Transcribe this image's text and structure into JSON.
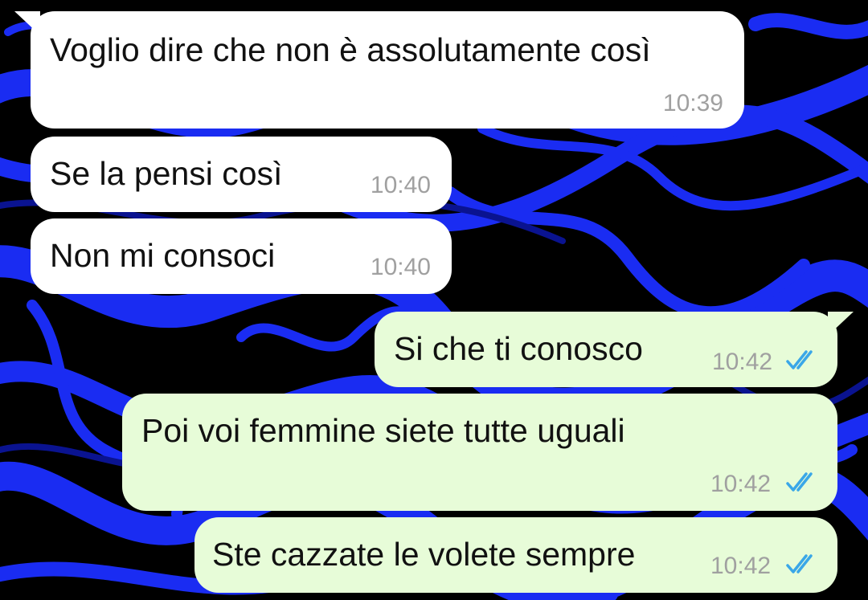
{
  "messages": [
    {
      "direction": "incoming",
      "text": "Voglio dire che non è assolutamente così",
      "time": "10:39"
    },
    {
      "direction": "incoming",
      "text": "Se la pensi così",
      "time": "10:40"
    },
    {
      "direction": "incoming",
      "text": "Non mi consoci",
      "time": "10:40"
    },
    {
      "direction": "outgoing",
      "text": "Si che ti conosco",
      "time": "10:42",
      "status_icon": "double-check-read-icon"
    },
    {
      "direction": "outgoing",
      "text": "Poi voi femmine siete tutte uguali",
      "time": "10:42",
      "status_icon": "double-check-read-icon"
    },
    {
      "direction": "outgoing",
      "text": "Ste cazzate le volete sempre",
      "time": "10:42",
      "status_icon": "double-check-read-icon"
    }
  ],
  "colors": {
    "wallpaper_base": "#000000",
    "wallpaper_swirl": "#1a2cf2",
    "incoming_bubble": "#ffffff",
    "outgoing_bubble": "#e7fcd8",
    "read_ticks": "#3aa7e8",
    "time_text": "#a0a0a0"
  }
}
